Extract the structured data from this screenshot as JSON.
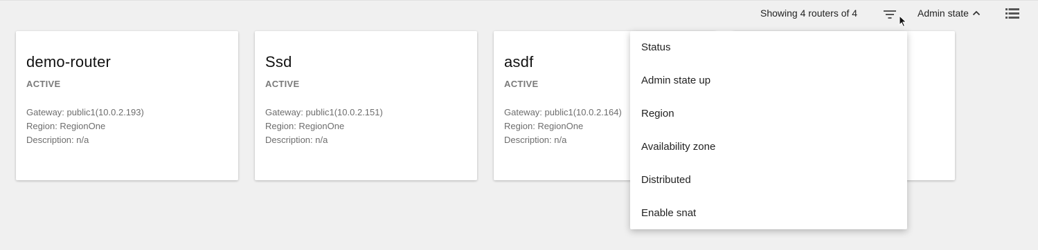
{
  "toolbar": {
    "count_text": "Showing 4 routers of 4",
    "sort_label": "Admin state"
  },
  "cards": [
    {
      "title": "demo-router",
      "status": "ACTIVE",
      "gateway": "Gateway: public1(10.0.2.193)",
      "region": "Region: RegionOne",
      "description": "Description: n/a"
    },
    {
      "title": "Ssd",
      "status": "ACTIVE",
      "gateway": "Gateway: public1(10.0.2.151)",
      "region": "Region: RegionOne",
      "description": "Description: n/a"
    },
    {
      "title": "asdf",
      "status": "ACTIVE",
      "gateway": "Gateway: public1(10.0.2.164)",
      "region": "Region: RegionOne",
      "description": "Description: n/a"
    }
  ],
  "dropdown": {
    "items": [
      "Status",
      "Admin state up",
      "Region",
      "Availability zone",
      "Distributed",
      "Enable snat"
    ]
  },
  "colors": {
    "background": "#f0f0f0",
    "card": "#ffffff",
    "status_text": "#7a7a7a"
  }
}
